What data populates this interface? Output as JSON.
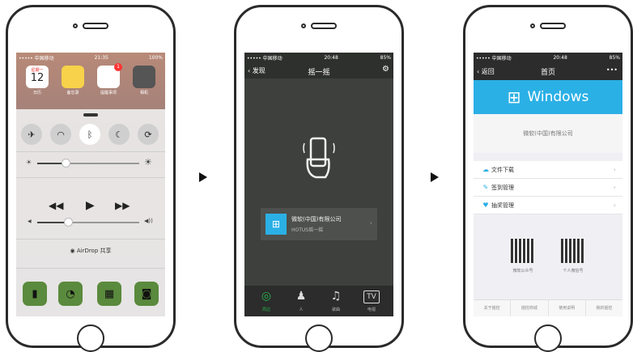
{
  "screen1": {
    "status": {
      "carrier": "••••• 中国移动",
      "time": "21:35",
      "battery": "100%"
    },
    "apps": [
      {
        "label": "日历",
        "day": "12",
        "weekday": "星期一",
        "color": "#ffffff"
      },
      {
        "label": "备忘录",
        "color": "#f7d24a"
      },
      {
        "label": "提醒事项",
        "color": "#ffffff",
        "badge": "1"
      },
      {
        "label": "相机",
        "color": "#555555"
      }
    ],
    "toggles": [
      "airplane-icon",
      "wifi-icon",
      "bluetooth-icon",
      "moon-icon",
      "rotation-lock-icon"
    ],
    "brightness": 0.28,
    "volume": 0.3,
    "airdrop_label": "AirDrop 共享",
    "shortcuts": [
      "flashlight-icon",
      "timer-icon",
      "calculator-icon",
      "camera-icon"
    ],
    "accent": "#5a8a3d"
  },
  "screen2": {
    "status": {
      "carrier": "••••• 中国移动",
      "time": "20:48",
      "battery": "85%"
    },
    "back_label": "发现",
    "title": "摇一摇",
    "card": {
      "name": "微软(中国)有限公司",
      "sub": "HOTUS摇一摇"
    },
    "tabs": [
      {
        "label": "周边",
        "icon": "signal-icon"
      },
      {
        "label": "人",
        "icon": "person-icon"
      },
      {
        "label": "歌曲",
        "icon": "music-icon"
      },
      {
        "label": "电视",
        "icon": "tv-icon"
      }
    ],
    "accent": "#2ab54e"
  },
  "screen3": {
    "status": {
      "carrier": "••••• 中国移动",
      "time": "20:48",
      "battery": "85%"
    },
    "back_label": "返回",
    "title": "首页",
    "more_label": "•••",
    "banner_text": "Windows",
    "company": "微软(中国)有限公司",
    "menu": [
      {
        "label": "文件下载",
        "icon": "download-icon"
      },
      {
        "label": "签到管理",
        "icon": "checkin-icon"
      },
      {
        "label": "抽奖管理",
        "icon": "prize-icon"
      }
    ],
    "qr": [
      {
        "label": "微软公众号"
      },
      {
        "label": "个人微信号"
      }
    ],
    "footer": [
      "关于摇控",
      "摇控商城",
      "使用说明",
      "我的摇控"
    ],
    "banner_color": "#2bb0e6"
  }
}
